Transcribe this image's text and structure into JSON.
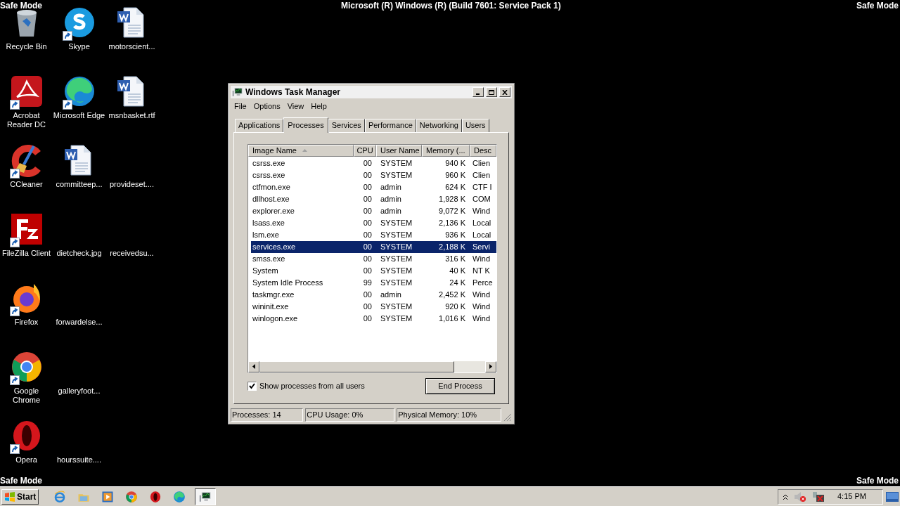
{
  "desktop": {
    "top_left": "Safe Mode",
    "title": "Microsoft (R) Windows (R) (Build 7601: Service Pack 1)",
    "top_right": "Safe Mode",
    "bottom_left": "Safe Mode",
    "bottom_right": "Safe Mode",
    "icons": [
      {
        "label": "Recycle Bin",
        "kind": "recycle",
        "shortcut": false
      },
      {
        "label": "Acrobat Reader DC",
        "kind": "acrobat",
        "shortcut": true
      },
      {
        "label": "CCleaner",
        "kind": "ccleaner",
        "shortcut": true
      },
      {
        "label": "FileZilla Client",
        "kind": "filezilla",
        "shortcut": true
      },
      {
        "label": "Firefox",
        "kind": "firefox",
        "shortcut": true
      },
      {
        "label": "Google Chrome",
        "kind": "chrome",
        "shortcut": true
      },
      {
        "label": "Opera",
        "kind": "opera",
        "shortcut": true
      },
      {
        "label": "Skype",
        "kind": "skype",
        "shortcut": true
      },
      {
        "label": "Microsoft Edge",
        "kind": "edge",
        "shortcut": true
      },
      {
        "label": "committeep...",
        "kind": "word",
        "shortcut": false
      },
      {
        "label": "dietcheck.jpg",
        "kind": "blank",
        "shortcut": false
      },
      {
        "label": "forwardelse...",
        "kind": "blank",
        "shortcut": false
      },
      {
        "label": "galleryfoot...",
        "kind": "blank",
        "shortcut": false
      },
      {
        "label": "hourssuite....",
        "kind": "blank",
        "shortcut": false
      },
      {
        "label": "motorscient...",
        "kind": "word",
        "shortcut": false
      },
      {
        "label": "msnbasket.rtf",
        "kind": "word",
        "shortcut": false
      },
      {
        "label": "provideset....",
        "kind": "blank",
        "shortcut": false
      },
      {
        "label": "receivedsu...",
        "kind": "blank",
        "shortcut": false
      }
    ]
  },
  "task_manager": {
    "title": "Windows Task Manager",
    "menu": [
      "File",
      "Options",
      "View",
      "Help"
    ],
    "tabs": [
      {
        "label": "Applications",
        "selected": false
      },
      {
        "label": "Processes",
        "selected": true
      },
      {
        "label": "Services",
        "selected": false
      },
      {
        "label": "Performance",
        "selected": false
      },
      {
        "label": "Networking",
        "selected": false
      },
      {
        "label": "Users",
        "selected": false
      }
    ],
    "table": {
      "columns": [
        {
          "label": "Image Name",
          "sorted": true
        },
        {
          "label": "CPU",
          "sorted": false
        },
        {
          "label": "User Name",
          "sorted": false
        },
        {
          "label": "Memory (...",
          "sorted": false
        },
        {
          "label": "Desc",
          "sorted": false
        }
      ],
      "rows": [
        {
          "cells": [
            "csrss.exe",
            "00",
            "SYSTEM",
            "940 K",
            "Clien"
          ],
          "selected": false
        },
        {
          "cells": [
            "csrss.exe",
            "00",
            "SYSTEM",
            "960 K",
            "Clien"
          ],
          "selected": false
        },
        {
          "cells": [
            "ctfmon.exe",
            "00",
            "admin",
            "624 K",
            "CTF I"
          ],
          "selected": false
        },
        {
          "cells": [
            "dllhost.exe",
            "00",
            "admin",
            "1,928 K",
            "COM"
          ],
          "selected": false
        },
        {
          "cells": [
            "explorer.exe",
            "00",
            "admin",
            "9,072 K",
            "Wind"
          ],
          "selected": false
        },
        {
          "cells": [
            "lsass.exe",
            "00",
            "SYSTEM",
            "2,136 K",
            "Local"
          ],
          "selected": false
        },
        {
          "cells": [
            "lsm.exe",
            "00",
            "SYSTEM",
            "936 K",
            "Local"
          ],
          "selected": false
        },
        {
          "cells": [
            "services.exe",
            "00",
            "SYSTEM",
            "2,188 K",
            "Servi"
          ],
          "selected": true
        },
        {
          "cells": [
            "smss.exe",
            "00",
            "SYSTEM",
            "316 K",
            "Wind"
          ],
          "selected": false
        },
        {
          "cells": [
            "System",
            "00",
            "SYSTEM",
            "40 K",
            "NT K"
          ],
          "selected": false
        },
        {
          "cells": [
            "System Idle Process",
            "99",
            "SYSTEM",
            "24 K",
            "Perce"
          ],
          "selected": false
        },
        {
          "cells": [
            "taskmgr.exe",
            "00",
            "admin",
            "2,452 K",
            "Wind"
          ],
          "selected": false
        },
        {
          "cells": [
            "wininit.exe",
            "00",
            "SYSTEM",
            "920 K",
            "Wind"
          ],
          "selected": false
        },
        {
          "cells": [
            "winlogon.exe",
            "00",
            "SYSTEM",
            "1,016 K",
            "Wind"
          ],
          "selected": false
        }
      ]
    },
    "show_all_users": {
      "label": "Show processes from all users",
      "checked": true
    },
    "end_button": "End Process",
    "status": [
      "Processes: 14",
      "CPU Usage: 0%",
      "Physical Memory: 10%"
    ]
  },
  "taskbar": {
    "start": "Start",
    "apps": [
      {
        "kind": "ie",
        "active": false
      },
      {
        "kind": "explorer",
        "active": false
      },
      {
        "kind": "media",
        "active": false
      },
      {
        "kind": "chrome",
        "active": false
      },
      {
        "kind": "opera",
        "active": false
      },
      {
        "kind": "edge",
        "active": false
      },
      {
        "kind": "taskmgr",
        "active": true
      }
    ],
    "tray": [
      {
        "kind": "caret"
      },
      {
        "kind": "speaker"
      },
      {
        "kind": "network"
      }
    ],
    "time": "4:15 PM"
  }
}
